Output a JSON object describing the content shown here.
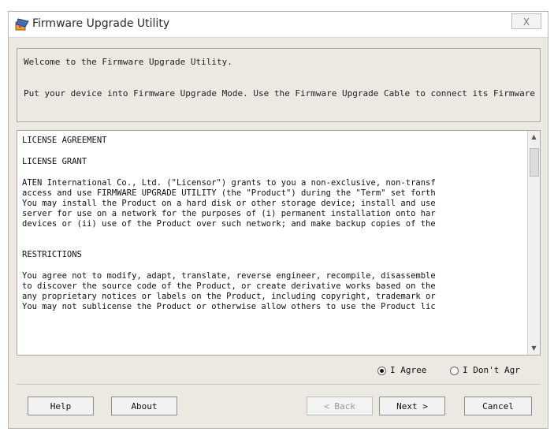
{
  "window": {
    "title": "Firmware Upgrade Utility",
    "close_label": "X"
  },
  "welcome": {
    "line1": "Welcome to the Firmware Upgrade Utility.",
    "line2": "Put your device into Firmware Upgrade Mode. Use the Firmware Upgrade Cable to connect its Firmware"
  },
  "license": {
    "heading1": "LICENSE AGREEMENT",
    "heading2": "LICENSE GRANT",
    "para1": [
      "ATEN International Co., Ltd. (\"Licensor\") grants to you a non-exclusive, non-transf",
      "access and use FIRMWARE UPGRADE UTILITY (the \"Product\") during the \"Term\" set forth",
      "You may install the Product on a hard disk or other storage device; install and use",
      "server for use on a network for the purposes of (i) permanent installation onto har",
      "devices or (ii) use of the Product over such network; and make backup copies of the"
    ],
    "heading3": "RESTRICTIONS",
    "para2": [
      "You agree not to modify, adapt, translate, reverse engineer, recompile, disassemble",
      "to discover the source code of the Product, or create derivative works based on the",
      "any proprietary notices or labels on the Product, including copyright, trademark or",
      "You may not sublicense the Product or otherwise allow others to use the Product lic"
    ]
  },
  "agreement": {
    "agree_label": "I Agree",
    "disagree_label": "I Don't Agr",
    "selected": "agree"
  },
  "buttons": {
    "help": "Help",
    "about": "About",
    "back": "< Back",
    "next": "Next >",
    "cancel": "Cancel"
  },
  "icons": {
    "app": "firmware-upgrade-app-icon",
    "close": "close-icon",
    "scroll_up": "scroll-up-arrow-icon",
    "scroll_down": "scroll-down-arrow-icon"
  }
}
